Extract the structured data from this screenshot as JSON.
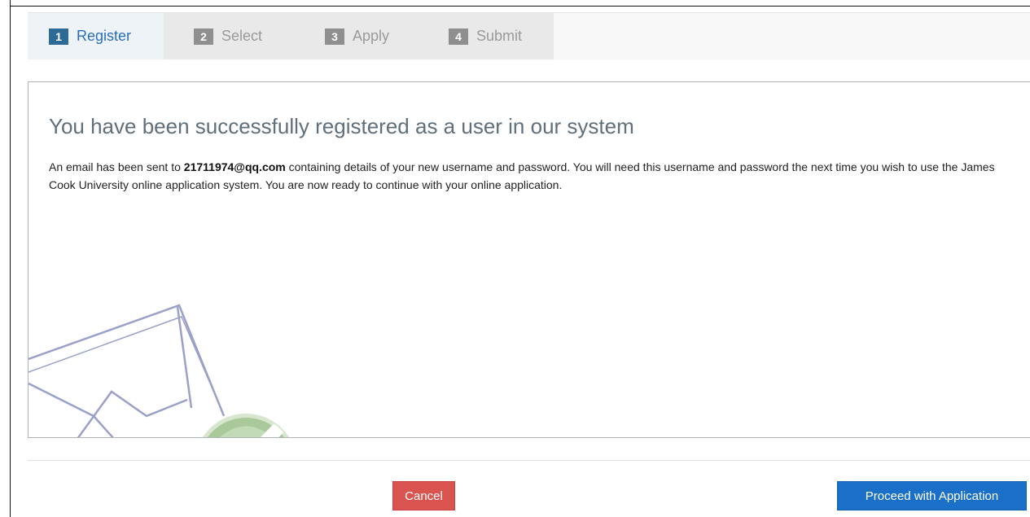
{
  "steps": [
    {
      "number": "1",
      "label": "Register",
      "state": "active"
    },
    {
      "number": "2",
      "label": "Select",
      "state": "inactive"
    },
    {
      "number": "3",
      "label": "Apply",
      "state": "inactive"
    },
    {
      "number": "4",
      "label": "Submit",
      "state": "inactive"
    }
  ],
  "panel": {
    "title": "You have been successfully registered as a user in our system",
    "message_before_email": "An email has been sent to ",
    "email": "21711974@qq.com",
    "message_after_email": " containing details of your new username and password. You will need this username and password the next time you wish to use the James Cook University online application system. You are now ready to continue with your online application.",
    "illustration_icon": "envelope-checkmark-icon"
  },
  "buttons": {
    "cancel_label": "Cancel",
    "proceed_label": "Proceed with Application"
  },
  "colors": {
    "active_step": "#2a6ebb",
    "cancel": "#d9534f",
    "proceed": "#1a6fc9",
    "check_badge": "#a9c99a"
  }
}
